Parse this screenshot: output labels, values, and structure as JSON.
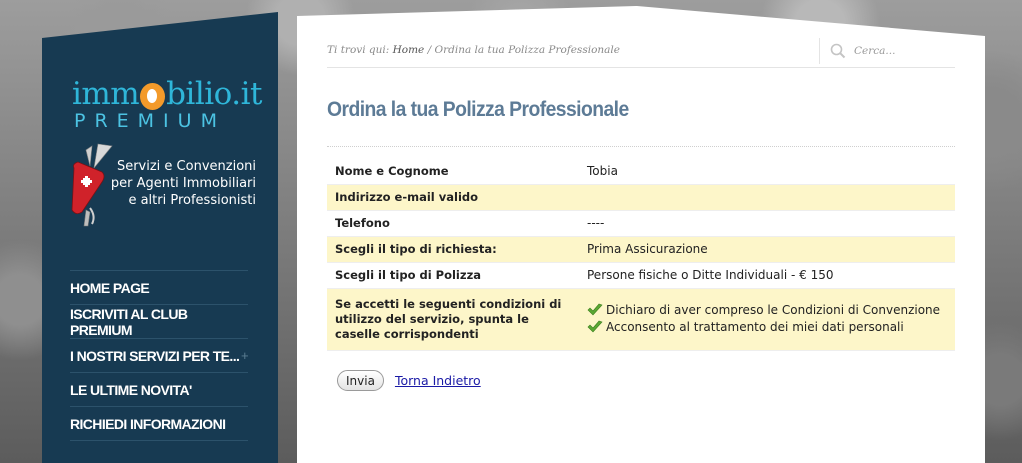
{
  "brand": {
    "logo_text_before": "imm",
    "logo_text_after": "bilio.it",
    "logo_sub": "PREMIUM",
    "tagline": [
      "Servizi e Convenzioni",
      "per Agenti Immobiliari",
      "e altri Professionisti"
    ]
  },
  "nav": {
    "items": [
      {
        "label": "HOME PAGE",
        "has_submenu": false
      },
      {
        "label": "ISCRIVITI AL CLUB PREMIUM",
        "has_submenu": false
      },
      {
        "label": "I NOSTRI SERVIZI PER TE...",
        "has_submenu": true
      },
      {
        "label": "LE ULTIME NOVITA'",
        "has_submenu": false
      },
      {
        "label": "RICHIEDI INFORMAZIONI",
        "has_submenu": false
      }
    ],
    "submenu_glyph": "+"
  },
  "breadcrumb": {
    "prefix": "Ti trovi qui: ",
    "home": "Home",
    "separator": " / ",
    "current": "Ordina la tua Polizza Professionale"
  },
  "search": {
    "placeholder": "Cerca...",
    "icon": "magnifier-icon"
  },
  "page": {
    "title": "Ordina la tua Polizza Professionale"
  },
  "form": {
    "rows": [
      {
        "label": "Nome e Cognome",
        "value": "Tobia"
      },
      {
        "label": "Indirizzo e-mail valido",
        "value": ""
      },
      {
        "label": "Telefono",
        "value": "----"
      },
      {
        "label": "Scegli il tipo di richiesta:",
        "value": "Prima Assicurazione"
      },
      {
        "label": "Scegli il tipo di Polizza",
        "value": "Persone fisiche o Ditte Individuali - € 150"
      }
    ],
    "conditions": {
      "label": "Se accetti le seguenti condizioni di utilizzo del servizio, spunta le caselle corrispondenti",
      "items": [
        "Dichiaro di aver compreso le Condizioni di Convenzione",
        "Acconsento al trattamento dei miei dati personali"
      ]
    },
    "submit_label": "Invia",
    "back_label": "Torna Indietro"
  },
  "colors": {
    "sidebar_bg": "#173a52",
    "logo_blue": "#2fb6d9",
    "logo_orange": "#f39a2a",
    "title_blue": "#5d7b96",
    "row_highlight": "#fdf6c9",
    "check_green": "#5aa832"
  }
}
